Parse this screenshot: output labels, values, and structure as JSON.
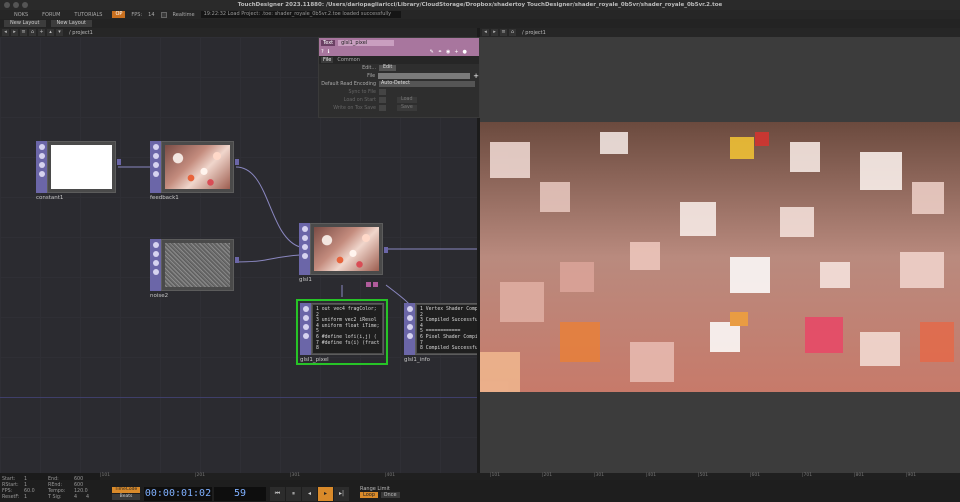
{
  "window": {
    "title": "TouchDesigner 2023.11880: /Users/dariopagliaricci/Library/CloudStorage/Dropbox/shadertoy TouchDesigner/shader_royale_0b5vr/shader_royale_0b5vr.2.toe"
  },
  "menubar": {
    "items": [
      "NOKS",
      "FORUM",
      "TUTORIALS"
    ],
    "perf_label": "OP",
    "fps_label": "FPS:",
    "fps_value": "14",
    "realtime_label": "Realtime",
    "message": "19:22:32 Load Project: .toe: shader_royale_0b5vr.2.toe loaded successfully"
  },
  "layoutbar": {
    "new_layout": "New Layout",
    "new_layout_2": "New Layout"
  },
  "panes": {
    "network_path": "/ project1",
    "viewer_path": "/ project1"
  },
  "nodes": {
    "constant": {
      "label": "constant1"
    },
    "feedback": {
      "label": "feedback1"
    },
    "noise": {
      "label": "noise2"
    },
    "glsl": {
      "label": "glsl1"
    },
    "glsl_pixel": {
      "label": "glsl1_pixel",
      "code": "1 out vec4 fragColor;\n2\n3 uniform vec2 iResol\n4 uniform float iTime;\n5\n6 #define lofi(i,j) (\n7 #define fs(i) (fract\n8"
    },
    "glsl_info": {
      "label": "glsl1_info",
      "code": "1 Vertex Shader Compi\n2\n3 Compiled Successful\n4\n5 ============\n6 Pixel Shader Compil\n7\n8 Compiled Successful"
    }
  },
  "params": {
    "op_type": "Text",
    "op_name": "glsl1_pixel",
    "tabs": [
      "File",
      "Common"
    ],
    "edit_label": "Edit...",
    "edit_btn": "Edit",
    "file_label": "File",
    "encoding_label": "Default Read Encoding",
    "encoding_value": "Auto-Detect",
    "sync_label": "Sync to File",
    "load_start_label": "Load on Start",
    "load_btn": "Load",
    "write_label": "Write on Tox Save",
    "save_btn": "Save"
  },
  "ruler": {
    "left_ticks": [
      "|101",
      "|201",
      "|301",
      "|401"
    ],
    "right_ticks": [
      "|101",
      "|201",
      "|301",
      "|401",
      "|501",
      "|601",
      "|701",
      "|801",
      "|901"
    ]
  },
  "stats": {
    "start_label": "Start:",
    "start": "1",
    "end_label": "End:",
    "end": "600",
    "rstart_label": "RStart:",
    "rstart": "1",
    "rend_label": "REnd:",
    "rend": "600",
    "fps_label": "FPS:",
    "fps": "60.0",
    "tempo_label": "Tempo:",
    "tempo": "120.0",
    "reset_label": "ResetF:",
    "reset": "1",
    "tsig_label": "T Sig:",
    "tsig_a": "4",
    "tsig_b": "4"
  },
  "timeline": {
    "timecode_btn": "TimeCode",
    "beats_btn": "Beats",
    "timecode": "00:00:01:02",
    "frame": "59",
    "range_label": "Range Limit",
    "loop_btn": "Loop",
    "once_btn": "Once"
  },
  "colors": {
    "op_purple": "#6b66a8",
    "text_dat_pink": "#a8769e",
    "selected_green": "#27c427",
    "accent_orange": "#d98a2a"
  }
}
